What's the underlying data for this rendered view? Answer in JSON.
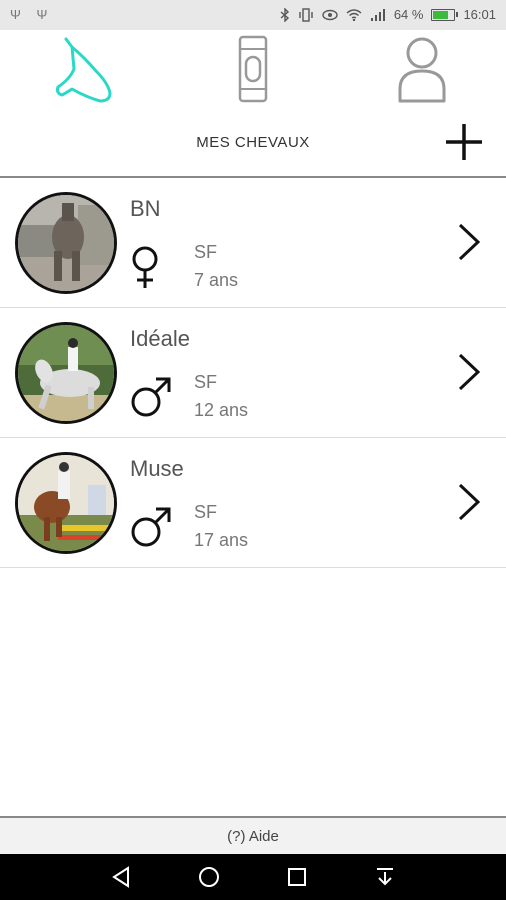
{
  "status_bar": {
    "left_icons": "Ψ Ψ",
    "battery": "64 %",
    "battery_level": 0.64,
    "time": "16:01"
  },
  "top_nav": {
    "tabs": [
      {
        "icon": "horse-head-icon",
        "active": true
      },
      {
        "icon": "horse-boot-icon",
        "active": false
      },
      {
        "icon": "user-profile-icon",
        "active": false
      }
    ],
    "accent_color": "#2ad8c8"
  },
  "header": {
    "title": "MES CHEVAUX",
    "add_icon": "plus-icon"
  },
  "horses": [
    {
      "name": "BN",
      "sex": "female",
      "breed": "SF",
      "age": "7 ans"
    },
    {
      "name": "Idéale",
      "sex": "male",
      "breed": "SF",
      "age": "12 ans"
    },
    {
      "name": "Muse",
      "sex": "male",
      "breed": "SF",
      "age": "17 ans"
    }
  ],
  "footer": {
    "help_label": "(?) Aide"
  },
  "android_nav": {
    "buttons": [
      "back-icon",
      "home-icon",
      "recents-icon",
      "download-icon"
    ]
  }
}
